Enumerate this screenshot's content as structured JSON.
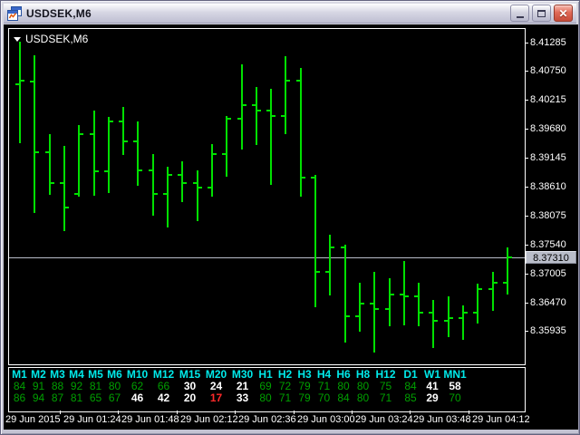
{
  "window": {
    "title": "USDSEK,M6",
    "controls": {
      "minimize": "minimize",
      "maximize": "maximize",
      "close": "close"
    }
  },
  "chart": {
    "symbol_label": "USDSEK,M6",
    "price_tag": "8.37310"
  },
  "colors": {
    "bar_green": "#00e000",
    "value_green": "#00a000",
    "value_white": "#ffffff",
    "value_red": "#ff2a2a",
    "header_cyan": "#00eaea",
    "price_line": "#b9bdc9",
    "tag_bg": "#b9bdc9",
    "chart_bg": "#000000"
  },
  "chart_data": {
    "type": "ohlc-bar",
    "symbol": "USDSEK",
    "timeframe": "M6",
    "current_price": 8.3731,
    "ylim": [
      8.3533,
      8.4152
    ],
    "grid": false,
    "price_axis_labels": [
      "8.41285",
      "8.40750",
      "8.40215",
      "8.39680",
      "8.39145",
      "8.38610",
      "8.38075",
      "8.37540",
      "8.37005",
      "8.36470",
      "8.35935"
    ],
    "time_axis_labels": [
      "29 Jun 2015",
      "29 Jun 01:24",
      "29 Jun 01:48",
      "29 Jun 02:12",
      "29 Jun 02:36",
      "29 Jun 03:00",
      "29 Jun 03:24",
      "29 Jun 03:48",
      "29 Jun 04:12"
    ],
    "bars": [
      {
        "o": 8.405,
        "h": 8.4129,
        "l": 8.3941,
        "c": 8.4058
      },
      {
        "o": 8.4055,
        "h": 8.4104,
        "l": 8.3812,
        "c": 8.3924
      },
      {
        "o": 8.3924,
        "h": 8.3959,
        "l": 8.3846,
        "c": 8.3868
      },
      {
        "o": 8.3868,
        "h": 8.3937,
        "l": 8.3778,
        "c": 8.3822
      },
      {
        "o": 8.3848,
        "h": 8.3975,
        "l": 8.3842,
        "c": 8.3958
      },
      {
        "o": 8.3958,
        "h": 8.4002,
        "l": 8.3845,
        "c": 8.389
      },
      {
        "o": 8.389,
        "h": 8.399,
        "l": 8.385,
        "c": 8.3982
      },
      {
        "o": 8.3982,
        "h": 8.4008,
        "l": 8.392,
        "c": 8.3945
      },
      {
        "o": 8.3945,
        "h": 8.3982,
        "l": 8.3862,
        "c": 8.3892
      },
      {
        "o": 8.3892,
        "h": 8.3922,
        "l": 8.3808,
        "c": 8.3848
      },
      {
        "o": 8.3848,
        "h": 8.3898,
        "l": 8.3786,
        "c": 8.3882
      },
      {
        "o": 8.3882,
        "h": 8.3908,
        "l": 8.3832,
        "c": 8.3868
      },
      {
        "o": 8.3868,
        "h": 8.3892,
        "l": 8.3798,
        "c": 8.386
      },
      {
        "o": 8.386,
        "h": 8.394,
        "l": 8.3842,
        "c": 8.3922
      },
      {
        "o": 8.3922,
        "h": 8.3992,
        "l": 8.388,
        "c": 8.3986
      },
      {
        "o": 8.3986,
        "h": 8.4088,
        "l": 8.393,
        "c": 8.4012
      },
      {
        "o": 8.4012,
        "h": 8.4045,
        "l": 8.3938,
        "c": 8.4002
      },
      {
        "o": 8.4002,
        "h": 8.4042,
        "l": 8.3864,
        "c": 8.3992
      },
      {
        "o": 8.3992,
        "h": 8.4102,
        "l": 8.3958,
        "c": 8.4058
      },
      {
        "o": 8.4058,
        "h": 8.408,
        "l": 8.3842,
        "c": 8.3878
      },
      {
        "o": 8.3878,
        "h": 8.3882,
        "l": 8.3638,
        "c": 8.3704
      },
      {
        "o": 8.3704,
        "h": 8.3772,
        "l": 8.366,
        "c": 8.3748
      },
      {
        "o": 8.3748,
        "h": 8.3754,
        "l": 8.3572,
        "c": 8.3622
      },
      {
        "o": 8.3622,
        "h": 8.3684,
        "l": 8.3592,
        "c": 8.3644
      },
      {
        "o": 8.3644,
        "h": 8.3704,
        "l": 8.3554,
        "c": 8.3634
      },
      {
        "o": 8.3634,
        "h": 8.3692,
        "l": 8.3602,
        "c": 8.3662
      },
      {
        "o": 8.3662,
        "h": 8.3724,
        "l": 8.3604,
        "c": 8.3658
      },
      {
        "o": 8.3658,
        "h": 8.3684,
        "l": 8.3602,
        "c": 8.3628
      },
      {
        "o": 8.3628,
        "h": 8.3652,
        "l": 8.3562,
        "c": 8.3612
      },
      {
        "o": 8.3612,
        "h": 8.3658,
        "l": 8.3582,
        "c": 8.3618
      },
      {
        "o": 8.3618,
        "h": 8.3642,
        "l": 8.3578,
        "c": 8.3628
      },
      {
        "o": 8.3628,
        "h": 8.3682,
        "l": 8.3608,
        "c": 8.3672
      },
      {
        "o": 8.3672,
        "h": 8.3704,
        "l": 8.3632,
        "c": 8.3684
      },
      {
        "o": 8.3684,
        "h": 8.3748,
        "l": 8.3662,
        "c": 8.3731
      }
    ]
  },
  "indicator_panel": {
    "headers": [
      "M1",
      "M2",
      "M3",
      "M4",
      "M5",
      "M6",
      "M10",
      "M12",
      "M15",
      "M20",
      "M30",
      "H1",
      "H2",
      "H3",
      "H4",
      "H6",
      "H8",
      "H12",
      "D1",
      "W1",
      "MN1"
    ],
    "rows": [
      {
        "values": [
          "84",
          "91",
          "88",
          "92",
          "81",
          "80",
          "62",
          "66",
          "30",
          "24",
          "21",
          "69",
          "72",
          "79",
          "71",
          "80",
          "80",
          "75",
          "84",
          "41",
          "58"
        ],
        "colors": [
          "g",
          "g",
          "g",
          "g",
          "g",
          "g",
          "g",
          "g",
          "w",
          "w",
          "w",
          "g",
          "g",
          "g",
          "g",
          "g",
          "g",
          "g",
          "g",
          "w",
          "w"
        ]
      },
      {
        "values": [
          "86",
          "94",
          "87",
          "81",
          "65",
          "67",
          "46",
          "42",
          "20",
          "17",
          "33",
          "80",
          "71",
          "79",
          "70",
          "84",
          "80",
          "71",
          "85",
          "29",
          "70"
        ],
        "colors": [
          "g",
          "g",
          "g",
          "g",
          "g",
          "g",
          "w",
          "w",
          "w",
          "r",
          "w",
          "g",
          "g",
          "g",
          "g",
          "g",
          "g",
          "g",
          "g",
          "w",
          "g"
        ]
      }
    ]
  }
}
